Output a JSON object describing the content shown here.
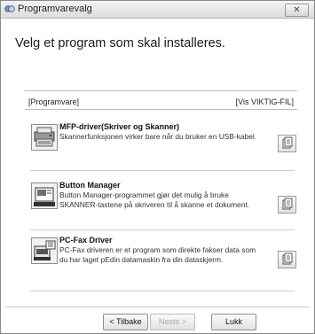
{
  "window": {
    "title": "Programvarevalg",
    "close_glyph": "✕"
  },
  "heading": "Velg et program som skal installeres.",
  "panel": {
    "left_label": "[Programvare]",
    "right_label": "[Vis VIKTIG-FIL]"
  },
  "items": [
    {
      "name": "MFP-driver(Skriver og Skanner)",
      "description": "Skannerfunksjonen virker bare når du bruker en USB-kabel.",
      "icon": "printer-scanner-icon",
      "doc_icon": "document-icon"
    },
    {
      "name": "Button Manager",
      "description": "Button Manager-programmet gjør det mulig å bruke SKANNER-tastene på skriveren til å skanne et dokument.",
      "icon": "button-manager-icon",
      "doc_icon": "document-icon"
    },
    {
      "name": "PC-Fax Driver",
      "description": "PC-Fax driveren er et program som direkte fakser data som du har laget pEdin datamaskin fra din dataskjerm.",
      "icon": "fax-icon",
      "doc_icon": "document-icon"
    }
  ],
  "footer": {
    "back": "< Tilbake",
    "next": "Neste >",
    "close": "Lukk"
  }
}
